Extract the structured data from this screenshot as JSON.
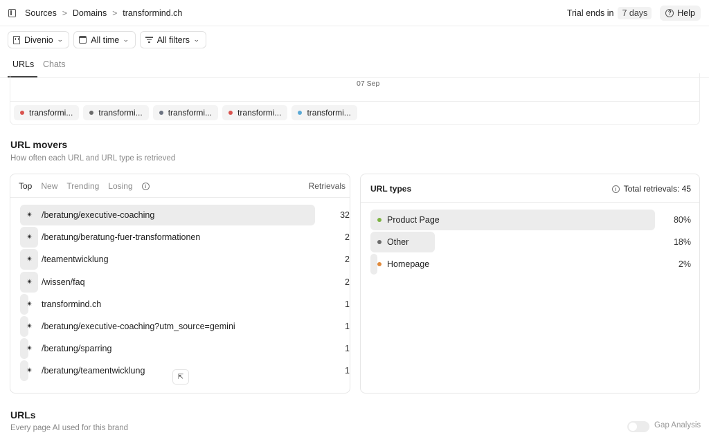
{
  "breadcrumb": {
    "items": [
      "Sources",
      "Domains",
      "transformind.ch"
    ],
    "separator": ">"
  },
  "header": {
    "trial_text": "Trial ends in",
    "trial_days": "7 days",
    "help_label": "Help"
  },
  "filters": {
    "brand": "Divenio",
    "time": "All time",
    "all_filters": "All filters"
  },
  "tabs": [
    {
      "label": "URLs",
      "active": true
    },
    {
      "label": "Chats",
      "active": false
    }
  ],
  "chart": {
    "x_tick": "07 Sep",
    "legend": [
      {
        "label": "transformi...",
        "color": "#d9534f"
      },
      {
        "label": "transformi...",
        "color": "#6b6b6b"
      },
      {
        "label": "transformi...",
        "color": "#6b7280"
      },
      {
        "label": "transformi...",
        "color": "#d9534f"
      },
      {
        "label": "transformi...",
        "color": "#5aa9d6"
      }
    ]
  },
  "movers": {
    "title": "URL movers",
    "subtitle": "How often each URL and URL type is retrieved",
    "tabs": [
      "Top",
      "New",
      "Trending",
      "Losing"
    ],
    "retrievals_header": "Retrievals",
    "rows": [
      {
        "url": "/beratung/executive-coaching",
        "count": 32
      },
      {
        "url": "/beratung/beratung-fuer-transformationen",
        "count": 2
      },
      {
        "url": "/teamentwicklung",
        "count": 2
      },
      {
        "url": "/wissen/faq",
        "count": 2
      },
      {
        "url": "transformind.ch",
        "count": 1
      },
      {
        "url": "/beratung/executive-coaching?utm_source=gemini",
        "count": 1
      },
      {
        "url": "/beratung/sparring",
        "count": 1
      },
      {
        "url": "/beratung/teamentwicklung",
        "count": 1
      }
    ]
  },
  "url_types": {
    "title": "URL types",
    "total_label": "Total retrievals: 45",
    "rows": [
      {
        "label": "Product Page",
        "value": "80%",
        "share": 0.8,
        "color": "#7cb342"
      },
      {
        "label": "Other",
        "value": "18%",
        "share": 0.18,
        "color": "#6b6b6b"
      },
      {
        "label": "Homepage",
        "value": "2%",
        "share": 0.02,
        "color": "#e08a3c"
      }
    ]
  },
  "urls": {
    "title": "URLs",
    "subtitle": "Every page AI used for this brand",
    "gap_analysis_label": "Gap Analysis"
  }
}
